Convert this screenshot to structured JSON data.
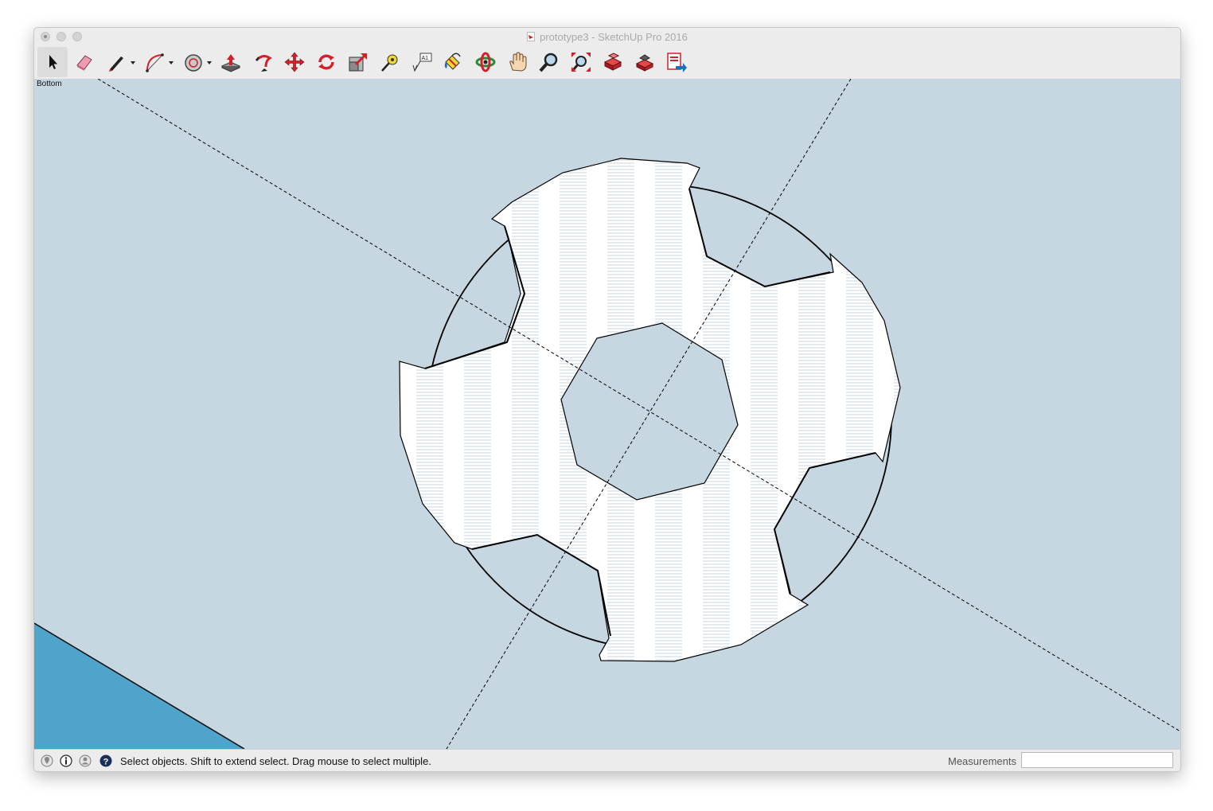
{
  "window": {
    "title": "prototype3 - SketchUp Pro 2016"
  },
  "toolbar": {
    "tools": [
      {
        "name": "select-tool",
        "icon": "arrow-cursor-icon",
        "active": true
      },
      {
        "name": "eraser-tool",
        "icon": "eraser-icon"
      },
      {
        "name": "line-tool",
        "icon": "pencil-icon",
        "has_dropdown": true
      },
      {
        "name": "arc-tool",
        "icon": "arc-icon",
        "has_dropdown": true
      },
      {
        "name": "shapes-tool",
        "icon": "circle-shape-icon",
        "has_dropdown": true
      },
      {
        "name": "push-pull-tool",
        "icon": "push-pull-icon"
      },
      {
        "name": "follow-me-tool",
        "icon": "follow-me-icon"
      },
      {
        "name": "move-tool",
        "icon": "move-arrows-icon"
      },
      {
        "name": "rotate-tool",
        "icon": "rotate-icon"
      },
      {
        "name": "scale-tool",
        "icon": "scale-icon"
      },
      {
        "name": "tape-measure-tool",
        "icon": "tape-measure-icon"
      },
      {
        "name": "text-tool",
        "icon": "text-label-icon"
      },
      {
        "name": "paint-bucket-tool",
        "icon": "paint-bucket-icon"
      },
      {
        "name": "orbit-tool",
        "icon": "orbit-icon"
      },
      {
        "name": "pan-tool",
        "icon": "hand-icon"
      },
      {
        "name": "zoom-tool",
        "icon": "magnifier-icon"
      },
      {
        "name": "zoom-extents-tool",
        "icon": "zoom-extents-icon"
      },
      {
        "name": "3d-warehouse-tool",
        "icon": "warehouse-icon"
      },
      {
        "name": "extension-warehouse-tool",
        "icon": "extension-warehouse-icon"
      },
      {
        "name": "send-to-layout-tool",
        "icon": "layout-icon"
      }
    ]
  },
  "view": {
    "label": "Bottom"
  },
  "statusbar": {
    "icons": [
      "geolocation-icon",
      "credits-icon",
      "user-icon",
      "help-icon"
    ],
    "message": "Select objects. Shift to extend select. Drag mouse to select multiple.",
    "measurements_label": "Measurements",
    "measurements_value": ""
  },
  "colors": {
    "canvas_background": "#c6d7e1",
    "ground_plane": "#4ea4cb",
    "face_fill": "#ffffff",
    "edge": "#000000",
    "tool_red": "#d4202a"
  }
}
